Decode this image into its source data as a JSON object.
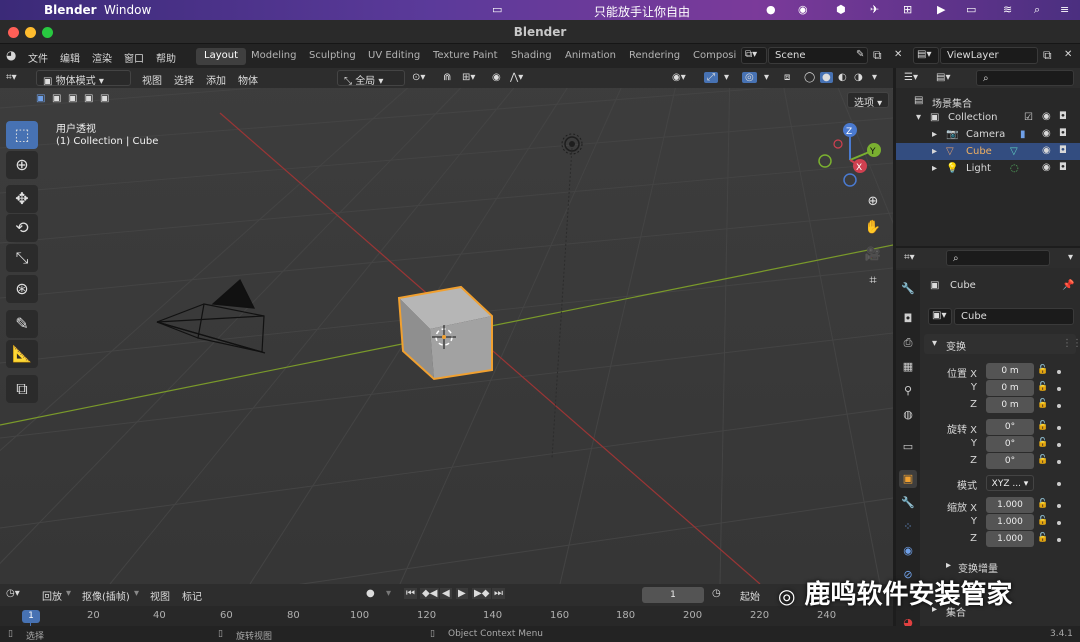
{
  "mac_menubar": {
    "app_name": "Blender",
    "menu": "Window",
    "center_text": "只能放手让你自由"
  },
  "window": {
    "title": "Blender"
  },
  "topbar": {
    "menus": [
      "文件",
      "编辑",
      "渲染",
      "窗口",
      "帮助"
    ],
    "workspaces": [
      "Layout",
      "Modeling",
      "Sculpting",
      "UV Editing",
      "Texture Paint",
      "Shading",
      "Animation",
      "Rendering",
      "Composi"
    ],
    "active_workspace": "Layout",
    "scene": "Scene",
    "view_layer": "ViewLayer"
  },
  "viewport": {
    "mode": "物体模式",
    "menus": [
      "视图",
      "选择",
      "添加",
      "物体"
    ],
    "orientation": "全局",
    "options_label": "选项",
    "info_line1": "用户透视",
    "info_line2": "(1) Collection | Cube",
    "gizmo": {
      "x": "X",
      "y": "Y",
      "z": "Z"
    }
  },
  "outliner": {
    "scene_collection": "场景集合",
    "collection": "Collection",
    "items": [
      {
        "label": "Camera",
        "selected": false
      },
      {
        "label": "Cube",
        "selected": true
      },
      {
        "label": "Light",
        "selected": false
      }
    ]
  },
  "properties": {
    "object_name": "Cube",
    "object_datablock": "Cube",
    "transform_header": "变换",
    "location_label": "位置 X",
    "rotation_label": "旋转 X",
    "scale_label": "缩放 X",
    "y_label": "Y",
    "z_label": "Z",
    "location": [
      "0 m",
      "0 m",
      "0 m"
    ],
    "rotation": [
      "0°",
      "0°",
      "0°"
    ],
    "mode_label": "模式",
    "rotation_mode": "XYZ ...",
    "scale": [
      "1.000",
      "1.000",
      "1.000"
    ],
    "delta_transform": "变换增量",
    "collections": "集合"
  },
  "timeline": {
    "menus": [
      "回放",
      "抠像(插帧)",
      "视图",
      "标记"
    ],
    "current_frame": "1",
    "start_label": "起始",
    "frame_ticks": [
      "20",
      "40",
      "60",
      "80",
      "100",
      "120",
      "140",
      "160",
      "180",
      "200",
      "220",
      "240"
    ],
    "current_marker": "1"
  },
  "statusbar": {
    "left": "选择",
    "middle": "旋转视图",
    "right": "Object Context Menu",
    "version": "3.4.1"
  },
  "watermark": "鹿鸣软件安装管家"
}
